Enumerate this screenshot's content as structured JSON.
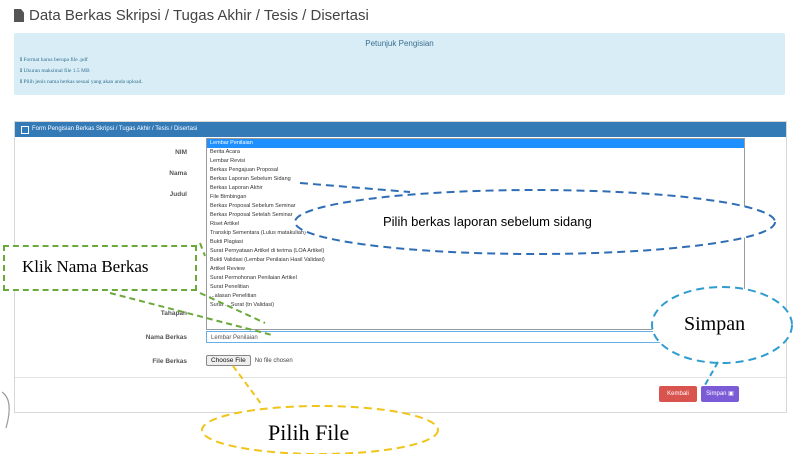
{
  "page": {
    "title": "Data Berkas Skripsi / Tugas Akhir / Tesis / Disertasi"
  },
  "info": {
    "title": "Petunjuk Pengisian",
    "lines": [
      "ℹ Format harus berupa file .pdf",
      "ℹ Ukuran maksimal file 1.5 MB",
      "ℹ Pilih jenis nama berkas sesuai yang akan anda upload."
    ]
  },
  "form": {
    "header": "Form Pengisian Berkas Skripsi / Tugas Akhir / Tesis / Disertasi",
    "labels": {
      "nim": "NIM",
      "nama": "Nama",
      "judul": "Judul",
      "tahapan": "Tahapan",
      "nama_berkas": "Nama Berkas",
      "file_berkas": "File Berkas"
    },
    "dropdown_options": [
      "Lembar Penilaian",
      "Berita Acara",
      "Lembar Revisi",
      "Berkas Pengajuan Proposal",
      "Berkas Laporan Sebelum Sidang",
      "Berkas Laporan Akhir",
      "File Bimbingan",
      "Berkas Proposal Sebelum Seminar",
      "Berkas Proposal Setelah Seminar",
      "Riset Artikel",
      "Transkip Sementara (Lulus matakuliah)",
      "Bukti Plagiasi",
      "Surat Pernyataan Artikel di terima (LOA Artikel)",
      "Bukti Validasi (Lembar Penilaian Hasil Validasi)",
      "Artikel Review",
      "Surat Permohonan Penilaian Artikel",
      "Surat Penelitian",
      "...alasan Penelitian",
      "Surat ... Surat (tn Validasi)"
    ],
    "selected_value": "Lembar Penilaian",
    "choose_file": "Choose File",
    "no_file": "No file chosen",
    "kembali": "Kembali",
    "simpan": "Simpan"
  },
  "annotations": {
    "klik": "Klik Nama Berkas",
    "pilih_berkas": "Pilih berkas laporan sebelum sidang",
    "simpan": "Simpan",
    "pilih_file": "Pilih File"
  },
  "colors": {
    "header_blue": "#337ab7",
    "info_bg": "#d9edf7",
    "selected_option": "#1e90ff",
    "kembali_red": "#d9534f",
    "simpan_purple": "#7b5bd6",
    "callout_blue": "#2f6db5",
    "callout_green": "#6aaa3a",
    "callout_yellow": "#f0c419"
  }
}
